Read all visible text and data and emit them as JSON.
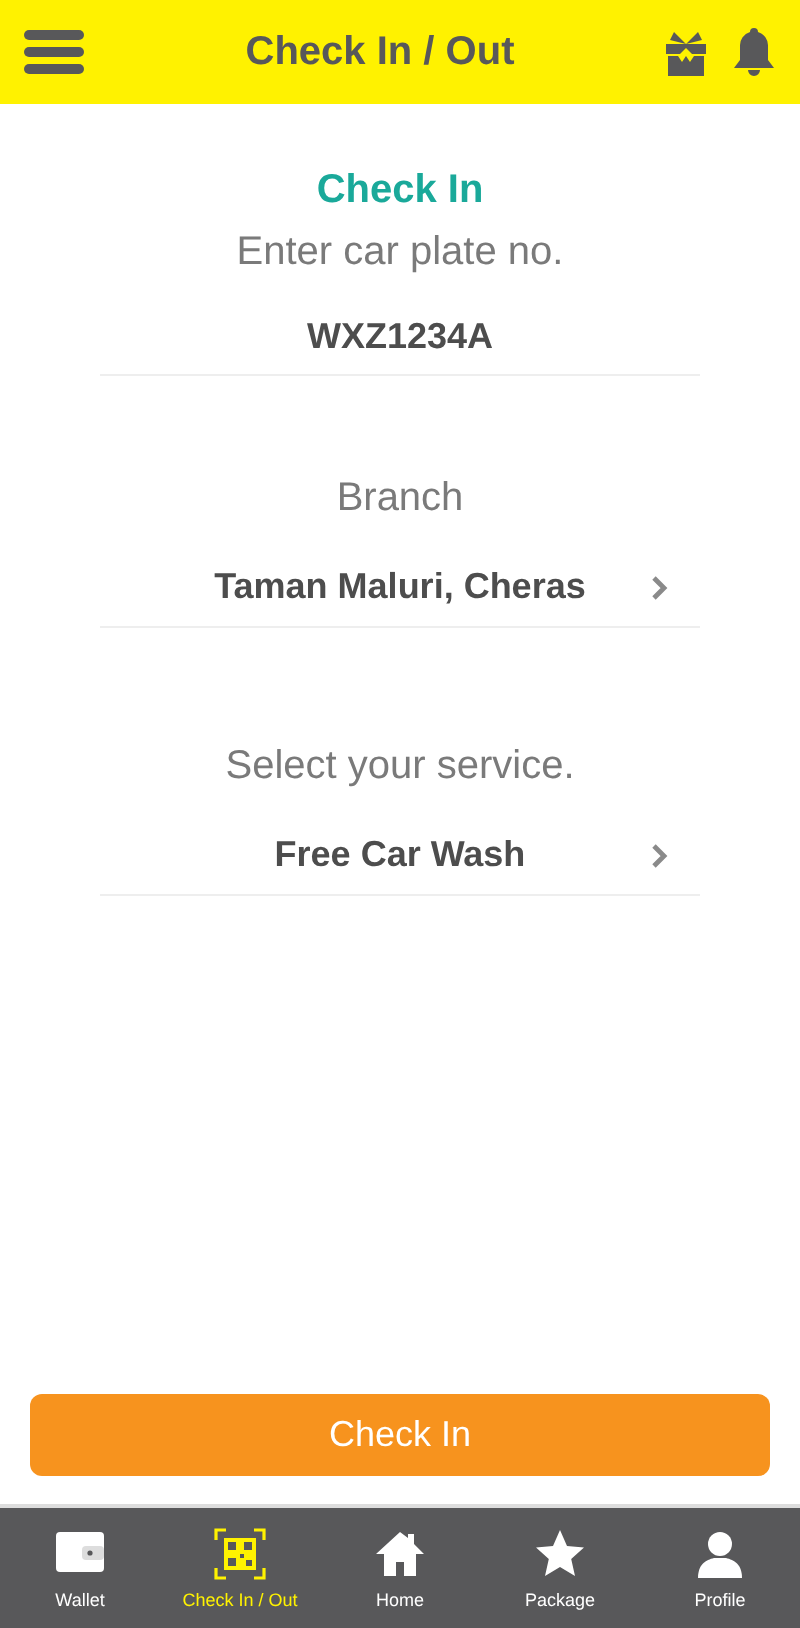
{
  "header": {
    "title": "Check In / Out"
  },
  "form": {
    "heading": "Check In",
    "fields": [
      {
        "kind": "text",
        "label": "Enter car plate no.",
        "value": "WXZ1234A"
      },
      {
        "kind": "select",
        "label": "Branch",
        "value": "Taman Maluri, Cheras"
      },
      {
        "kind": "select",
        "label": "Select your service.",
        "value": "Free Car Wash"
      }
    ]
  },
  "submit": {
    "label": "Check In"
  },
  "nav": [
    {
      "kind": "wallet",
      "label": "Wallet",
      "selected": false
    },
    {
      "kind": "qr",
      "label": "Check In / Out",
      "selected": true
    },
    {
      "kind": "home",
      "label": "Home",
      "selected": false
    },
    {
      "kind": "star",
      "label": "Package",
      "selected": false
    },
    {
      "kind": "profile",
      "label": "Profile",
      "selected": false
    }
  ]
}
